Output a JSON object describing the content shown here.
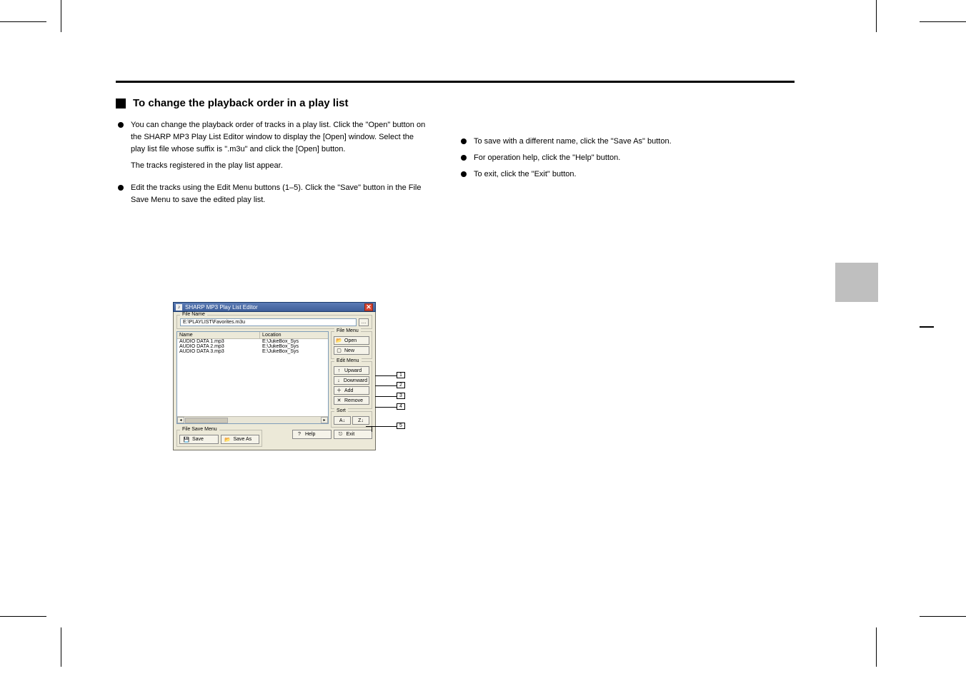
{
  "section": {
    "title": "To change the playback order in a play list"
  },
  "left": {
    "intro": "You can change the playback order of tracks in a play list. Click the \"Open\" button on the SHARP MP3 Play List Editor window to display the [Open] window. Select the play list file whose suffix is \".m3u\" and click the [Open] button.",
    "tracksNote": "The tracks registered in the play list appear.",
    "editSteps": "Edit the tracks using the Edit Menu buttons (1–5). Click the \"Save\" button in the File Save Menu to save the edited play list."
  },
  "right": {
    "items": [
      "To save with a different name, click the \"Save As\" button.",
      "For operation help, click the \"Help\" button.",
      "To exit, click the \"Exit\" button."
    ]
  },
  "screenshot": {
    "windowTitle": "SHARP MP3 Play List Editor",
    "fileNameLabel": "File Name",
    "fileNameValue": "E:\\PLAYLIST\\Favorites.m3u",
    "table": {
      "headers": {
        "name": "Name",
        "location": "Location"
      },
      "rows": [
        {
          "name": "AUDIO DATA 1.mp3",
          "location": "E:\\JukeBox_Sys"
        },
        {
          "name": "AUDIO DATA 2.mp3",
          "location": "E:\\JukeBox_Sys"
        },
        {
          "name": "AUDIO DATA 3.mp3",
          "location": "E:\\JukeBox_Sys"
        }
      ]
    },
    "sidebar": {
      "fileMenu": {
        "label": "File Menu",
        "open": "Open",
        "new": "New"
      },
      "editMenu": {
        "label": "Edit Menu",
        "upward": "Upward",
        "downward": "Downward",
        "add": "Add",
        "remove": "Remove"
      },
      "sort": {
        "label": "Sort"
      }
    },
    "bottom": {
      "fileSaveLabel": "File Save Menu",
      "save": "Save",
      "saveAs": "Save As",
      "help": "Help",
      "exit": "Exit"
    },
    "callouts": [
      "1",
      "2",
      "3",
      "4",
      "5"
    ]
  }
}
